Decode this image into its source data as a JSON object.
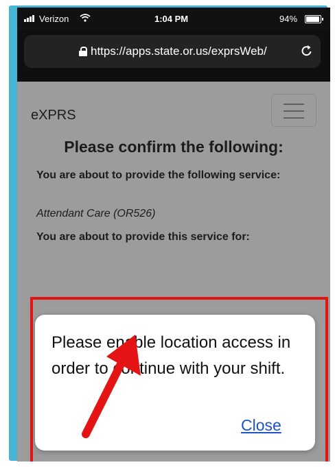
{
  "status_bar": {
    "carrier": "Verizon",
    "time": "1:04 PM",
    "battery_percent": "94%",
    "battery_level": 0.94
  },
  "browser": {
    "url": "https://apps.state.or.us/exprsWeb/",
    "icons": [
      "lock-icon",
      "reload-icon"
    ]
  },
  "app": {
    "title": "eXPRS",
    "menu_icon": "hamburger-menu-icon"
  },
  "page": {
    "heading": "Please confirm the following:",
    "service_label": "You are about to provide the following service:",
    "service_value": "Attendant Care (OR526)",
    "recipient_label": "You are about to provide this service for:"
  },
  "dialog": {
    "message": "Please enable location access in order to continue with your shift.",
    "close_label": "Close"
  },
  "colors": {
    "frame": "#46b4d2",
    "highlight": "#e51414",
    "arrow": "#e51414",
    "link": "#1d53c4"
  }
}
